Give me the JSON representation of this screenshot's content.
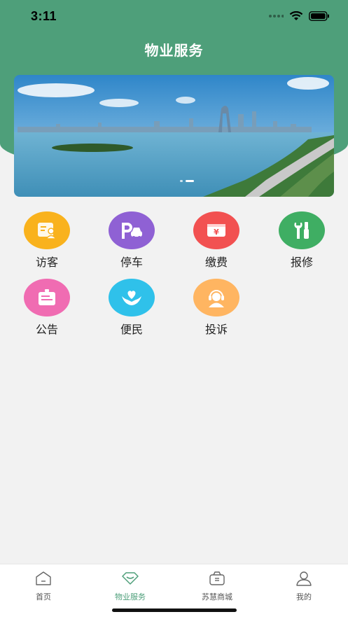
{
  "status_bar": {
    "time": "3:11"
  },
  "header": {
    "title": "物业服务"
  },
  "banner": {
    "slide_count": 2,
    "active_slide": 2
  },
  "services": [
    {
      "label": "访客",
      "icon": "visitor-card-icon",
      "color": "#f9b21d"
    },
    {
      "label": "停车",
      "icon": "parking-icon",
      "color": "#8f61d4"
    },
    {
      "label": "缴费",
      "icon": "payment-yen-icon",
      "color": "#f25151"
    },
    {
      "label": "报修",
      "icon": "repair-tools-icon",
      "color": "#3fae63"
    },
    {
      "label": "公告",
      "icon": "announcement-board-icon",
      "color": "#f06cb2"
    },
    {
      "label": "便民",
      "icon": "heart-hands-icon",
      "color": "#2fc1ea"
    },
    {
      "label": "投诉",
      "icon": "complaint-headset-icon",
      "color": "#ffb561"
    }
  ],
  "tabbar": {
    "items": [
      {
        "label": "首页",
        "icon": "home-icon",
        "active": false
      },
      {
        "label": "物业服务",
        "icon": "diamond-icon",
        "active": true
      },
      {
        "label": "苏慧商城",
        "icon": "shop-basket-icon",
        "active": false
      },
      {
        "label": "我的",
        "icon": "user-icon",
        "active": false
      }
    ]
  }
}
